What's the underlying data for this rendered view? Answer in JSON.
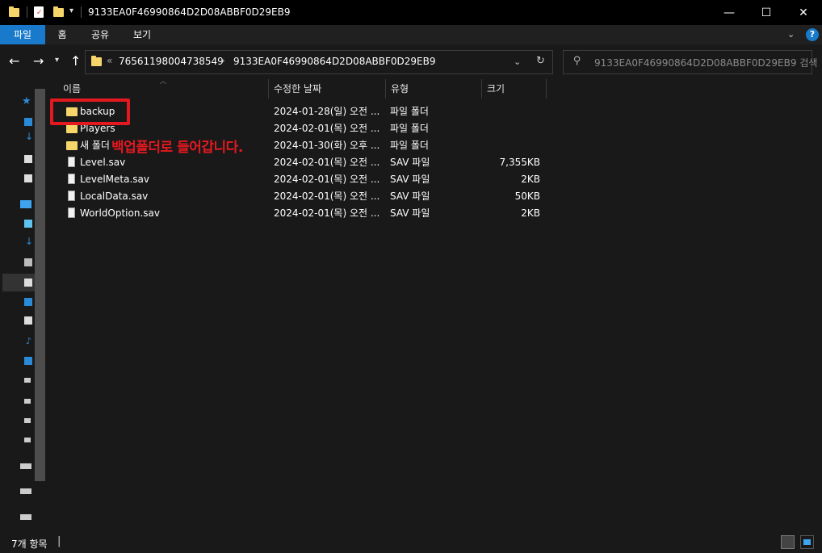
{
  "window": {
    "title": "9133EA0F46990864D2D08ABBF0D29EB9",
    "controls": {
      "minimize": "—",
      "maximize": "☐",
      "close": "✕"
    }
  },
  "ribbon": {
    "tabs": [
      "파일",
      "홈",
      "공유",
      "보기"
    ],
    "help": "?"
  },
  "address": {
    "overflow": "«",
    "crumbs": [
      "76561198004738549",
      "9133EA0F46990864D2D08ABBF0D29EB9"
    ],
    "separator": "›"
  },
  "search": {
    "placeholder": "9133EA0F46990864D2D08ABBF0D29EB9 검색"
  },
  "columns": {
    "name": "이름",
    "date": "수정한 날짜",
    "type": "유형",
    "size": "크기"
  },
  "files": [
    {
      "name": "backup",
      "date": "2024-01-28(일) 오전 ...",
      "type": "파일 폴더",
      "size": "",
      "kind": "folder"
    },
    {
      "name": "Players",
      "date": "2024-02-01(목) 오전 ...",
      "type": "파일 폴더",
      "size": "",
      "kind": "folder"
    },
    {
      "name": "새 폴더",
      "date": "2024-01-30(화) 오후 ...",
      "type": "파일 폴더",
      "size": "",
      "kind": "folder"
    },
    {
      "name": "Level.sav",
      "date": "2024-02-01(목) 오전 ...",
      "type": "SAV 파일",
      "size": "7,355KB",
      "kind": "file"
    },
    {
      "name": "LevelMeta.sav",
      "date": "2024-02-01(목) 오전 ...",
      "type": "SAV 파일",
      "size": "2KB",
      "kind": "file"
    },
    {
      "name": "LocalData.sav",
      "date": "2024-02-01(목) 오전 ...",
      "type": "SAV 파일",
      "size": "50KB",
      "kind": "file"
    },
    {
      "name": "WorldOption.sav",
      "date": "2024-02-01(목) 오전 ...",
      "type": "SAV 파일",
      "size": "2KB",
      "kind": "file"
    }
  ],
  "annotation": {
    "text": "백업폴더로 들어갑니다."
  },
  "status": {
    "count": "7개 항목",
    "cursor": "|"
  },
  "colors": {
    "accent": "#1979ca",
    "annotation": "#e3191f",
    "folder": "#f6d66b"
  }
}
